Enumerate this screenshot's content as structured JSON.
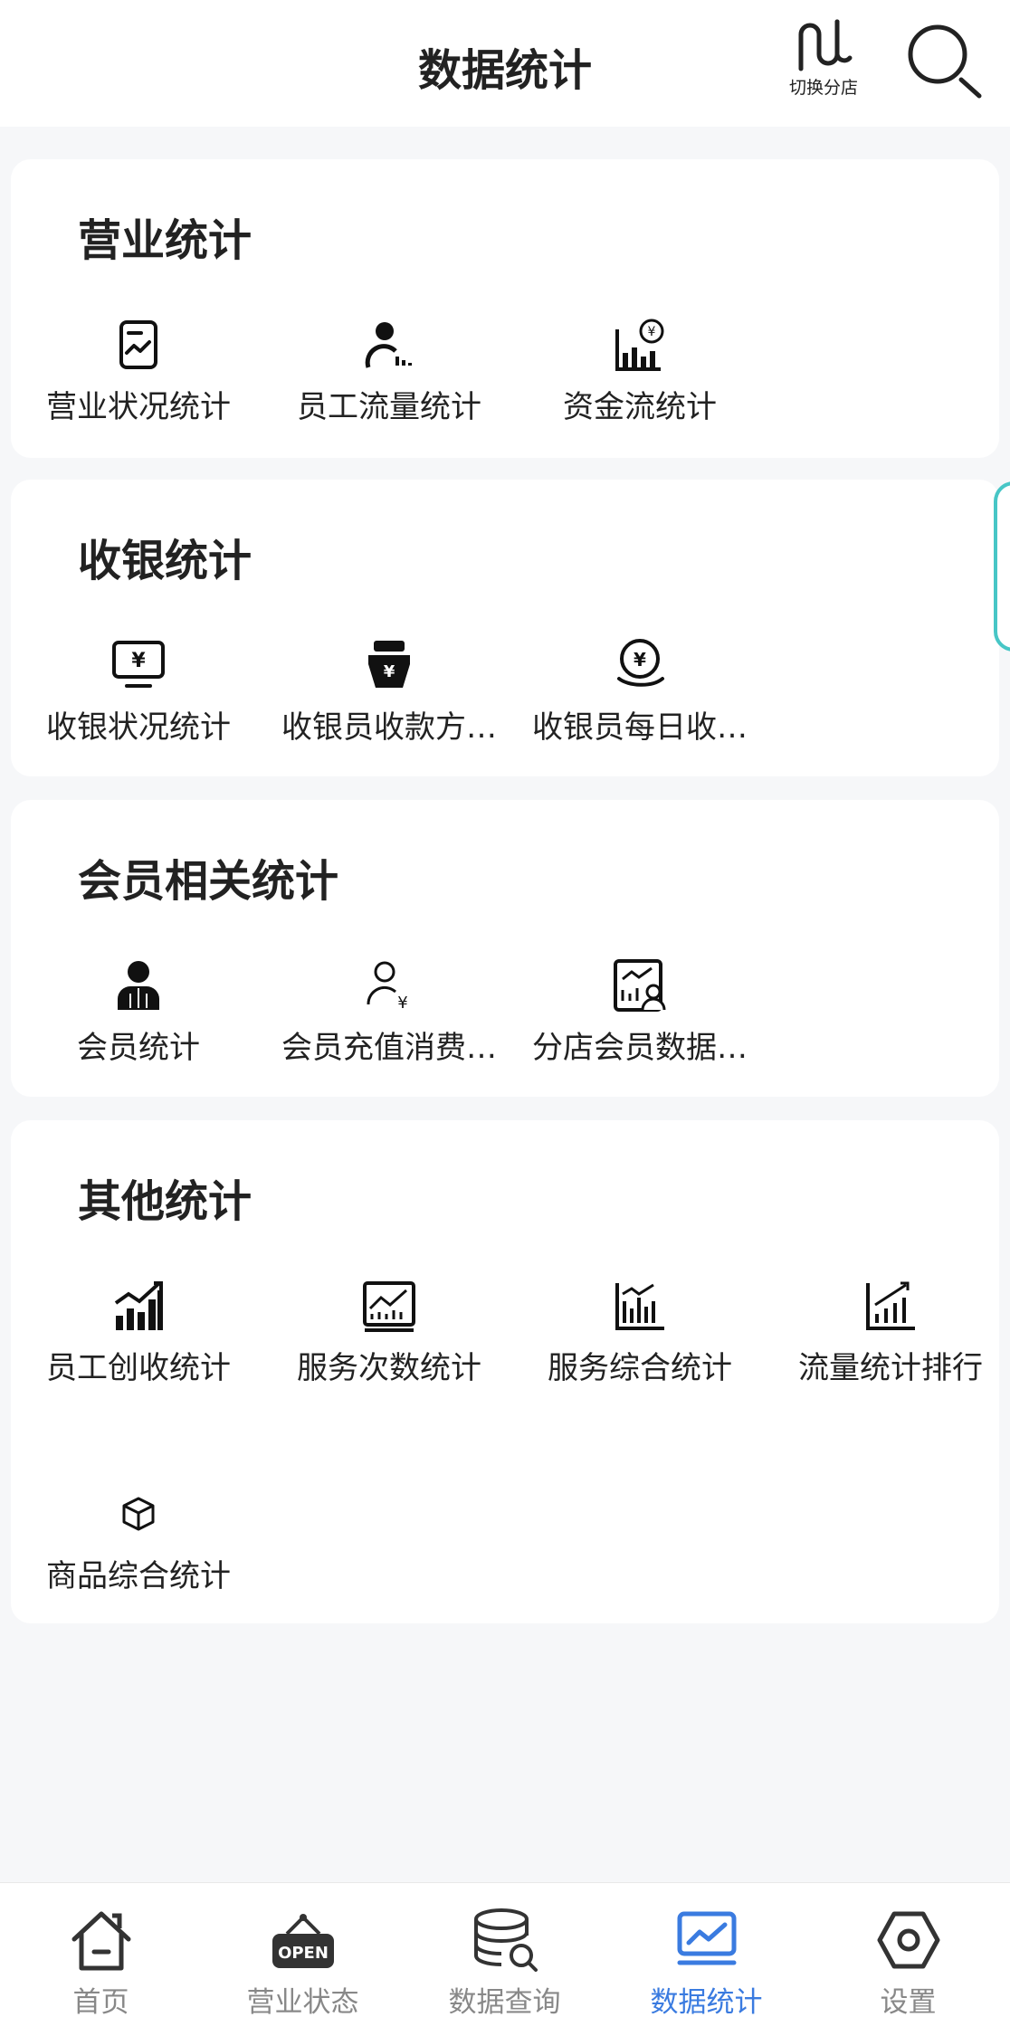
{
  "header": {
    "title": "数据统计",
    "switch_store_label": "切换分店",
    "search_icon": "search-icon"
  },
  "sections": [
    {
      "title": "营业统计",
      "items": [
        {
          "label": "营业状况统计",
          "icon": "business-report-icon"
        },
        {
          "label": "员工流量统计",
          "icon": "staff-flow-icon"
        },
        {
          "label": "资金流统计",
          "icon": "cash-flow-icon"
        }
      ]
    },
    {
      "title": "收银统计",
      "items": [
        {
          "label": "收银状况统计",
          "icon": "cashier-monitor-icon"
        },
        {
          "label": "收银员收款方…",
          "icon": "cashier-payment-icon"
        },
        {
          "label": "收银员每日收…",
          "icon": "cashier-daily-icon"
        }
      ]
    },
    {
      "title": "会员相关统计",
      "items": [
        {
          "label": "会员统计",
          "icon": "member-icon"
        },
        {
          "label": "会员充值消费…",
          "icon": "member-recharge-icon"
        },
        {
          "label": "分店会员数据…",
          "icon": "branch-member-data-icon"
        }
      ]
    },
    {
      "title": "其他统计",
      "items": [
        {
          "label": "员工创收统计",
          "icon": "staff-revenue-icon"
        },
        {
          "label": "服务次数统计",
          "icon": "service-count-icon"
        },
        {
          "label": "服务综合统计",
          "icon": "service-summary-icon"
        },
        {
          "label": "流量统计排行",
          "icon": "traffic-ranking-icon"
        },
        {
          "label": "商品综合统计",
          "icon": "product-summary-icon"
        }
      ]
    }
  ],
  "tabbar": {
    "tabs": [
      {
        "label": "首页",
        "icon": "home-icon"
      },
      {
        "label": "营业状态",
        "icon": "open-sign-icon"
      },
      {
        "label": "数据查询",
        "icon": "database-search-icon"
      },
      {
        "label": "数据统计",
        "icon": "chart-icon",
        "active": true
      },
      {
        "label": "设置",
        "icon": "settings-icon"
      }
    ]
  },
  "colors": {
    "active_tab": "#3a7be0",
    "inactive_tab": "#888888",
    "accent_handle": "#47c6c6"
  }
}
